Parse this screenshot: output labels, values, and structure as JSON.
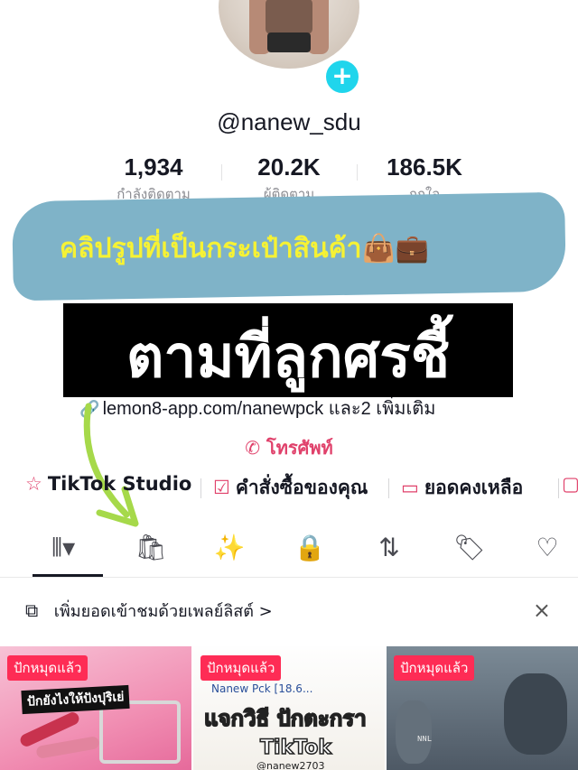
{
  "profile": {
    "username": "@nanew_sdu",
    "follow_plus": "+"
  },
  "stats": [
    {
      "value": "1,934",
      "label": "กำลังติดตาม"
    },
    {
      "value": "20.2K",
      "label": "ผู้ติดตาม"
    },
    {
      "value": "186.5K",
      "label": "ถูกใจ"
    }
  ],
  "overlay": {
    "banner_text": "คลิปรูปที่เป็นกระเป๋าสินค้า👜💼",
    "black_text": "ตามที่ลูกศรชี้"
  },
  "bio": {
    "link_text": "lemon8-app.com/nanewpck และ2 เพิ่มเติม",
    "phone_label": "โทรศัพท์"
  },
  "tools": [
    {
      "label": "TikTok Studio",
      "icon": "person-star-icon"
    },
    {
      "label": "คำสั่งซื้อของคุณ",
      "icon": "clipboard-check-icon"
    },
    {
      "label": "ยอดคงเหลือ",
      "icon": "wallet-icon"
    }
  ],
  "tabs": [
    {
      "icon": "grid-videos-icon",
      "glyph": "⦀▾"
    },
    {
      "icon": "shopping-bag-icon",
      "glyph": "🛍"
    },
    {
      "icon": "magic-wand-icon",
      "glyph": "✨"
    },
    {
      "icon": "lock-icon",
      "glyph": "🔒"
    },
    {
      "icon": "repost-icon",
      "glyph": "⇅"
    },
    {
      "icon": "bookmark-icon",
      "glyph": "🏷"
    },
    {
      "icon": "heart-icon",
      "glyph": "♡"
    }
  ],
  "playlist": {
    "text": "เพิ่มยอดเข้าชมด้วยเพลย์ลิสต์ >",
    "close": "×"
  },
  "videos": [
    {
      "pinned": "ปักหมุดแล้ว",
      "caption": "ปักยังไงให้ปังปุริเย่"
    },
    {
      "pinned": "ปักหมุดแล้ว",
      "subtitle": "Nanew Pck [18.6...",
      "caption": "แจกวิธี ปักตะกรา",
      "caption2": "TikTok",
      "handle": "@nanew2703"
    },
    {
      "pinned": "ปักหมุดแล้ว",
      "small_text": "NNL"
    }
  ],
  "colors": {
    "accent_pink": "#fe2c55",
    "phone_pink": "#e0416b",
    "follow_cyan": "#20d5ec",
    "banner_blue": "#7fb3c8",
    "banner_text_yellow": "#f6f234",
    "arrow_green": "#a6d94a"
  }
}
